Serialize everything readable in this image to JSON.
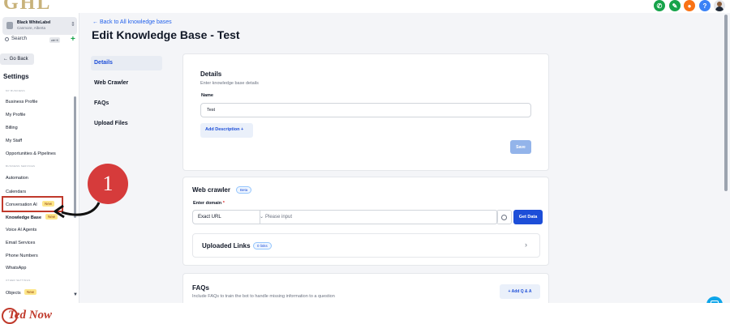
{
  "brand": {
    "logo_text": "GHL"
  },
  "header_icons": [
    {
      "name": "phone-icon",
      "color": "#16a34a",
      "glyph": "✆"
    },
    {
      "name": "megaphone-icon",
      "color": "#16a34a",
      "glyph": "✎"
    },
    {
      "name": "notification-icon",
      "color": "#f97316",
      "glyph": "●"
    },
    {
      "name": "help-icon",
      "color": "#3b82f6",
      "glyph": "?"
    }
  ],
  "sidebar": {
    "location_name": "Black WhiteLabel",
    "location_sub": "Canmore, Alberta",
    "search_label": "Search",
    "search_shortcut": "ctrl K",
    "go_back": "← Go Back",
    "settings_title": "Settings",
    "section_my_business": "MY BUSINESS",
    "section_business_services": "BUSINESS SERVICES",
    "section_other_settings": "OTHER SETTINGS",
    "items": [
      {
        "label": "Business Profile"
      },
      {
        "label": "My Profile"
      },
      {
        "label": "Billing"
      },
      {
        "label": "My Staff"
      },
      {
        "label": "Opportunities & Pipelines"
      },
      {
        "label": "Automation"
      },
      {
        "label": "Calendars"
      },
      {
        "label": "Conversation AI",
        "badge": "New"
      },
      {
        "label": "Knowledge Base",
        "badge": "New"
      },
      {
        "label": "Voice AI Agents"
      },
      {
        "label": "Email Services"
      },
      {
        "label": "Phone Numbers"
      },
      {
        "label": "WhatsApp"
      },
      {
        "label": "Objects",
        "badge": "New"
      }
    ]
  },
  "annotation": {
    "step_number": "1"
  },
  "main": {
    "back_link": "←  Back to All knowledge bases",
    "title": "Edit Knowledge Base - Test",
    "tabs": [
      {
        "label": "Details",
        "active": true
      },
      {
        "label": "Web Crawler"
      },
      {
        "label": "FAQs"
      },
      {
        "label": "Upload Files"
      }
    ],
    "details": {
      "heading": "Details",
      "subheading": "Enter knowledge base details",
      "name_label": "Name",
      "name_value": "Test",
      "add_description": "Add Description +",
      "save": "Save"
    },
    "web_crawler": {
      "heading": "Web crawler",
      "beta_badge": "Beta",
      "domain_label": "Enter domain",
      "domain_required": "*",
      "url_type": "Exact URL",
      "domain_placeholder": "Please input",
      "get_data": "Get Data",
      "uploaded_links_title": "Uploaded Links",
      "links_count": "0 links"
    },
    "faqs": {
      "heading": "FAQs",
      "subheading": "Include FAQs to train the bot to handle missing information to a question",
      "add_qa": "+ Add Q & A"
    }
  },
  "footer": {
    "logo_text": "Ted Now"
  }
}
